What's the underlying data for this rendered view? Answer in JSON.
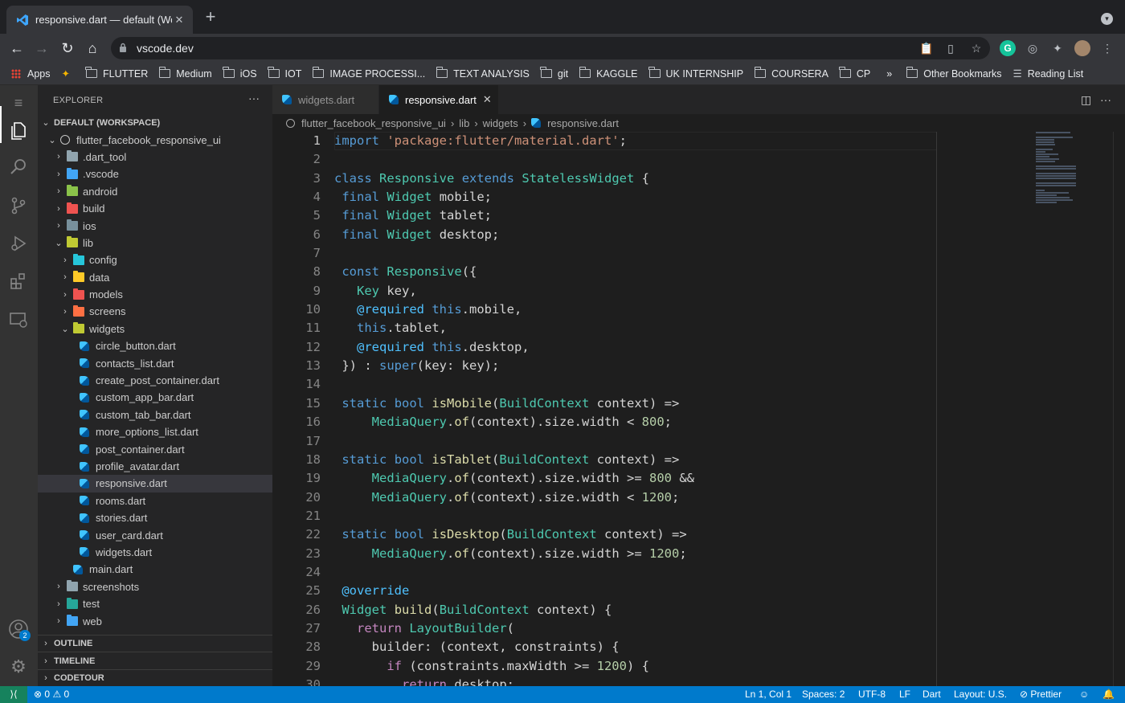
{
  "browser": {
    "tab_title": "responsive.dart — default (Wor",
    "new_tab": "+",
    "url": "vscode.dev",
    "bookmarks": [
      {
        "label": "Apps",
        "icon": "apps-grid-icon"
      },
      {
        "label": "",
        "icon": "star-icon"
      },
      {
        "label": "FLUTTER",
        "icon": "folder-icon"
      },
      {
        "label": "Medium",
        "icon": "folder-icon"
      },
      {
        "label": "iOS",
        "icon": "folder-icon"
      },
      {
        "label": "IOT",
        "icon": "folder-icon"
      },
      {
        "label": "IMAGE PROCESSI...",
        "icon": "folder-icon"
      },
      {
        "label": "TEXT ANALYSIS",
        "icon": "folder-icon"
      },
      {
        "label": "git",
        "icon": "folder-icon"
      },
      {
        "label": "KAGGLE",
        "icon": "folder-icon"
      },
      {
        "label": "UK INTERNSHIP",
        "icon": "folder-icon"
      },
      {
        "label": "COURSERA",
        "icon": "folder-icon"
      },
      {
        "label": "CP",
        "icon": "folder-icon"
      }
    ],
    "overflow": "»",
    "other_bookmarks": "Other Bookmarks",
    "reading_list": "Reading List"
  },
  "sidebar": {
    "header": "EXPLORER",
    "more": "···",
    "workspace": "DEFAULT (WORKSPACE)",
    "tree": [
      {
        "label": "flutter_facebook_responsive_ui",
        "type": "root",
        "depth": 1,
        "open": true
      },
      {
        "label": ".dart_tool",
        "type": "folder",
        "depth": 2,
        "color": "#90a4ae"
      },
      {
        "label": ".vscode",
        "type": "folder",
        "depth": 2,
        "color": "#42a5f5"
      },
      {
        "label": "android",
        "type": "folder",
        "depth": 2,
        "color": "#8bc34a"
      },
      {
        "label": "build",
        "type": "folder",
        "depth": 2,
        "color": "#ef5350"
      },
      {
        "label": "ios",
        "type": "folder",
        "depth": 2,
        "color": "#78909c"
      },
      {
        "label": "lib",
        "type": "folder",
        "depth": 2,
        "color": "#c0ca33",
        "open": true
      },
      {
        "label": "config",
        "type": "folder",
        "depth": 3,
        "color": "#26c6da"
      },
      {
        "label": "data",
        "type": "folder",
        "depth": 3,
        "color": "#ffca28"
      },
      {
        "label": "models",
        "type": "folder",
        "depth": 3,
        "color": "#ef5350"
      },
      {
        "label": "screens",
        "type": "folder",
        "depth": 3,
        "color": "#ff7043"
      },
      {
        "label": "widgets",
        "type": "folder",
        "depth": 3,
        "color": "#c0ca33",
        "open": true
      },
      {
        "label": "circle_button.dart",
        "type": "dart",
        "depth": 4
      },
      {
        "label": "contacts_list.dart",
        "type": "dart",
        "depth": 4
      },
      {
        "label": "create_post_container.dart",
        "type": "dart",
        "depth": 4
      },
      {
        "label": "custom_app_bar.dart",
        "type": "dart",
        "depth": 4
      },
      {
        "label": "custom_tab_bar.dart",
        "type": "dart",
        "depth": 4
      },
      {
        "label": "more_options_list.dart",
        "type": "dart",
        "depth": 4
      },
      {
        "label": "post_container.dart",
        "type": "dart",
        "depth": 4
      },
      {
        "label": "profile_avatar.dart",
        "type": "dart",
        "depth": 4
      },
      {
        "label": "responsive.dart",
        "type": "dart",
        "depth": 4,
        "selected": true
      },
      {
        "label": "rooms.dart",
        "type": "dart",
        "depth": 4
      },
      {
        "label": "stories.dart",
        "type": "dart",
        "depth": 4
      },
      {
        "label": "user_card.dart",
        "type": "dart",
        "depth": 4
      },
      {
        "label": "widgets.dart",
        "type": "dart",
        "depth": 4
      },
      {
        "label": "main.dart",
        "type": "dart",
        "depth": 3
      },
      {
        "label": "screenshots",
        "type": "folder",
        "depth": 2,
        "color": "#90a4ae"
      },
      {
        "label": "test",
        "type": "folder",
        "depth": 2,
        "color": "#26a69a"
      },
      {
        "label": "web",
        "type": "folder",
        "depth": 2,
        "color": "#42a5f5"
      }
    ],
    "panels": [
      "OUTLINE",
      "TIMELINE",
      "CODETOUR"
    ],
    "accounts_badge": "2"
  },
  "editor": {
    "tabs": [
      {
        "label": "widgets.dart",
        "active": false
      },
      {
        "label": "responsive.dart",
        "active": true
      }
    ],
    "close": "✕",
    "breadcrumbs": [
      "flutter_facebook_responsive_ui",
      "lib",
      "widgets",
      "responsive.dart"
    ],
    "breadcrumb_sep": "›",
    "current_line": 1,
    "lines": [
      [
        [
          "kw",
          "import"
        ],
        [
          "",
          ""
        ],
        [
          "str",
          " 'package:flutter/material.dart'"
        ],
        [
          "",
          ";"
        ]
      ],
      [],
      [
        [
          "kw",
          "class"
        ],
        [
          "",
          " "
        ],
        [
          "ty",
          "Responsive"
        ],
        [
          "",
          " "
        ],
        [
          "kw",
          "extends"
        ],
        [
          "",
          " "
        ],
        [
          "ty",
          "StatelessWidget"
        ],
        [
          "",
          " {"
        ]
      ],
      [
        [
          "",
          " "
        ],
        [
          "kw",
          "final"
        ],
        [
          "",
          " "
        ],
        [
          "ty",
          "Widget"
        ],
        [
          "",
          " mobile;"
        ]
      ],
      [
        [
          "",
          " "
        ],
        [
          "kw",
          "final"
        ],
        [
          "",
          " "
        ],
        [
          "ty",
          "Widget"
        ],
        [
          "",
          " tablet;"
        ]
      ],
      [
        [
          "",
          " "
        ],
        [
          "kw",
          "final"
        ],
        [
          "",
          " "
        ],
        [
          "ty",
          "Widget"
        ],
        [
          "",
          " desktop;"
        ]
      ],
      [],
      [
        [
          "",
          " "
        ],
        [
          "kw",
          "const"
        ],
        [
          "",
          " "
        ],
        [
          "ty",
          "Responsive"
        ],
        [
          "",
          "({"
        ]
      ],
      [
        [
          "",
          "   "
        ],
        [
          "ty",
          "Key"
        ],
        [
          "",
          " key,"
        ]
      ],
      [
        [
          "",
          "   "
        ],
        [
          "at",
          "@required"
        ],
        [
          "",
          " "
        ],
        [
          "kw",
          "this"
        ],
        [
          "",
          ".mobile,"
        ]
      ],
      [
        [
          "",
          "   "
        ],
        [
          "kw",
          "this"
        ],
        [
          "",
          ".tablet,"
        ]
      ],
      [
        [
          "",
          "   "
        ],
        [
          "at",
          "@required"
        ],
        [
          "",
          " "
        ],
        [
          "kw",
          "this"
        ],
        [
          "",
          ".desktop,"
        ]
      ],
      [
        [
          "",
          " }) : "
        ],
        [
          "kw",
          "super"
        ],
        [
          "",
          "(key: key);"
        ]
      ],
      [],
      [
        [
          "",
          " "
        ],
        [
          "kw",
          "static"
        ],
        [
          "",
          " "
        ],
        [
          "kw",
          "bool"
        ],
        [
          "",
          " "
        ],
        [
          "fn",
          "isMobile"
        ],
        [
          "",
          "("
        ],
        [
          "ty",
          "BuildContext"
        ],
        [
          "",
          " context) =>"
        ]
      ],
      [
        [
          "",
          "     "
        ],
        [
          "ty",
          "MediaQuery"
        ],
        [
          "",
          "."
        ],
        [
          "fn",
          "of"
        ],
        [
          "",
          "(context).size.width < "
        ],
        [
          "num",
          "800"
        ],
        [
          "",
          ";"
        ]
      ],
      [],
      [
        [
          "",
          " "
        ],
        [
          "kw",
          "static"
        ],
        [
          "",
          " "
        ],
        [
          "kw",
          "bool"
        ],
        [
          "",
          " "
        ],
        [
          "fn",
          "isTablet"
        ],
        [
          "",
          "("
        ],
        [
          "ty",
          "BuildContext"
        ],
        [
          "",
          " context) =>"
        ]
      ],
      [
        [
          "",
          "     "
        ],
        [
          "ty",
          "MediaQuery"
        ],
        [
          "",
          "."
        ],
        [
          "fn",
          "of"
        ],
        [
          "",
          "(context).size.width >= "
        ],
        [
          "num",
          "800"
        ],
        [
          "",
          " &&"
        ]
      ],
      [
        [
          "",
          "     "
        ],
        [
          "ty",
          "MediaQuery"
        ],
        [
          "",
          "."
        ],
        [
          "fn",
          "of"
        ],
        [
          "",
          "(context).size.width < "
        ],
        [
          "num",
          "1200"
        ],
        [
          "",
          ";"
        ]
      ],
      [],
      [
        [
          "",
          " "
        ],
        [
          "kw",
          "static"
        ],
        [
          "",
          " "
        ],
        [
          "kw",
          "bool"
        ],
        [
          "",
          " "
        ],
        [
          "fn",
          "isDesktop"
        ],
        [
          "",
          "("
        ],
        [
          "ty",
          "BuildContext"
        ],
        [
          "",
          " context) =>"
        ]
      ],
      [
        [
          "",
          "     "
        ],
        [
          "ty",
          "MediaQuery"
        ],
        [
          "",
          "."
        ],
        [
          "fn",
          "of"
        ],
        [
          "",
          "(context).size.width >= "
        ],
        [
          "num",
          "1200"
        ],
        [
          "",
          ";"
        ]
      ],
      [],
      [
        [
          "",
          " "
        ],
        [
          "at",
          "@override"
        ]
      ],
      [
        [
          "",
          " "
        ],
        [
          "ty",
          "Widget"
        ],
        [
          "",
          " "
        ],
        [
          "fn",
          "build"
        ],
        [
          "",
          "("
        ],
        [
          "ty",
          "BuildContext"
        ],
        [
          "",
          " context) {"
        ]
      ],
      [
        [
          "",
          "   "
        ],
        [
          "ctl",
          "return"
        ],
        [
          "",
          " "
        ],
        [
          "ty",
          "LayoutBuilder"
        ],
        [
          "",
          "("
        ]
      ],
      [
        [
          "",
          "     builder: (context, constraints) {"
        ]
      ],
      [
        [
          "",
          "       "
        ],
        [
          "ctl",
          "if"
        ],
        [
          "",
          " (constraints.maxWidth >= "
        ],
        [
          "num",
          "1200"
        ],
        [
          "",
          ") {"
        ]
      ],
      [
        [
          "",
          "         "
        ],
        [
          "ctl",
          "return"
        ],
        [
          "",
          " desktop;"
        ]
      ]
    ]
  },
  "status_bar": {
    "remote": "⟩⟨",
    "errors": "0",
    "warnings": "0",
    "position": "Ln 1, Col 1",
    "spaces": "Spaces: 2",
    "encoding": "UTF-8",
    "eol": "LF",
    "language": "Dart",
    "layout": "Layout: U.S.",
    "prettier": "Prettier"
  }
}
